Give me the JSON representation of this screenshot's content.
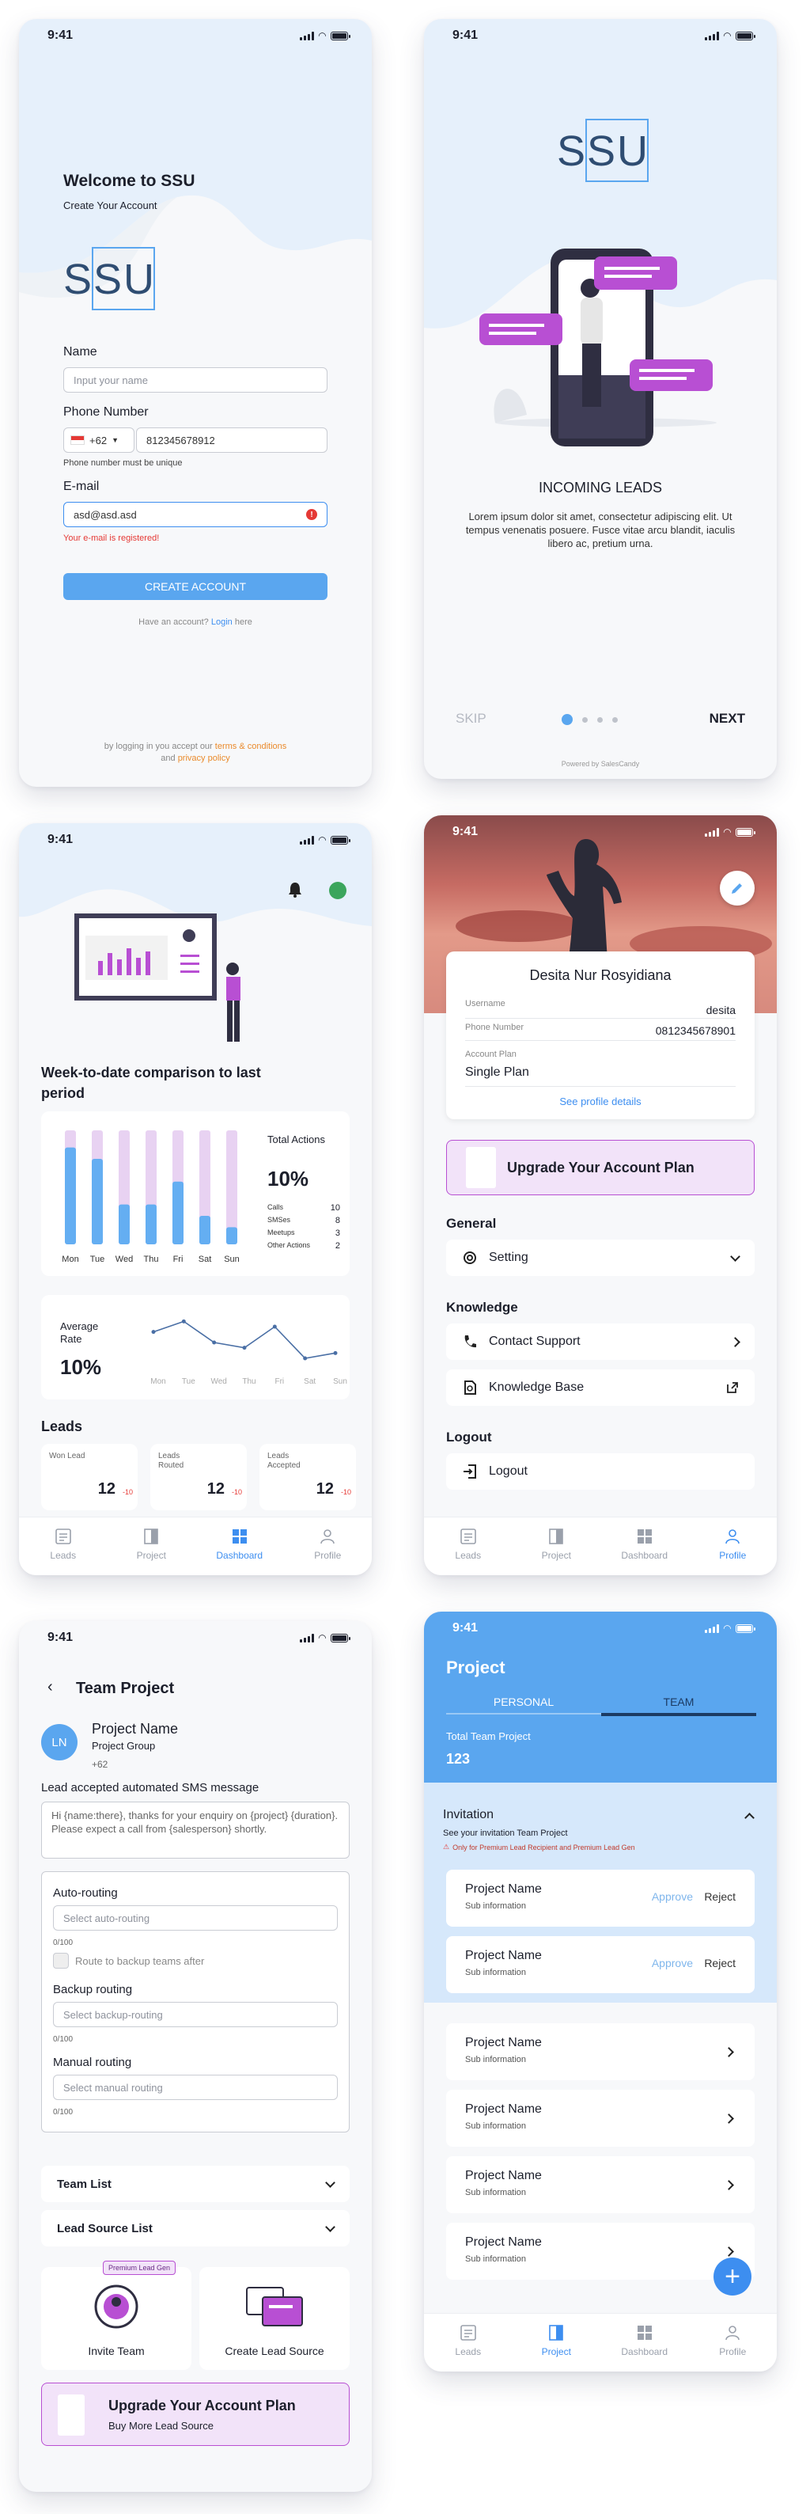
{
  "colors": {
    "primary": "#5aa6ef",
    "accent": "#3d8ef0",
    "purple": "#b84fd3",
    "error": "#e53935",
    "orange": "#ea8a2b",
    "light_blue": "#e6f0fb"
  },
  "status": {
    "time": "9:41"
  },
  "signup": {
    "welcome": "Welcome to SSU",
    "subtitle": "Create Your Account",
    "logo": "SSU",
    "name_label": "Name",
    "name_placeholder": "Input your name",
    "phone_label": "Phone Number",
    "country_code": "+62",
    "phone_value": "812345678912",
    "phone_hint": "Phone number must be unique",
    "email_label": "E-mail",
    "email_value": "asd@asd.asd",
    "email_error": "Your e-mail is registered!",
    "create_button": "CREATE ACCOUNT",
    "have_account": "Have an account?",
    "login_link": "Login",
    "here": "here",
    "terms_prefix": "by logging in you accept our",
    "terms_link": "terms & conditions",
    "and": "and",
    "privacy_link": "privacy policy"
  },
  "onboard": {
    "logo": "SSU",
    "title": "INCOMING LEADS",
    "body": "Lorem ipsum dolor sit amet, consectetur adipiscing elit. Ut tempus venenatis posuere. Fusce vitae arcu blandit, iaculis libero ac, pretium urna.",
    "skip": "SKIP",
    "next": "NEXT",
    "powered": "Powered by SalesCandy"
  },
  "dashboard": {
    "headline": "Week-to-date comparison to last period",
    "total_label": "Total Actions",
    "total_value": "10%",
    "stats": [
      {
        "label": "Calls",
        "value": "10"
      },
      {
        "label": "SMSes",
        "value": "8"
      },
      {
        "label": "Meetups",
        "value": "3"
      },
      {
        "label": "Other Actions",
        "value": "2"
      }
    ],
    "avg_label": "Average Rate",
    "avg_value": "10%",
    "leads_title": "Leads",
    "leads": [
      {
        "label": "Won Lead",
        "value": "12",
        "delta": "-10"
      },
      {
        "label": "Leads Routed",
        "value": "12",
        "delta": "-10"
      },
      {
        "label": "Leads Accepted",
        "value": "12",
        "delta": "-10"
      }
    ]
  },
  "chart_data": [
    {
      "type": "bar",
      "categories": [
        "Mon",
        "Tue",
        "Wed",
        "Thu",
        "Fri",
        "Sat",
        "Sun"
      ],
      "series": [
        {
          "values": [
            85,
            75,
            35,
            35,
            55,
            25,
            15
          ]
        },
        {
          "values": [
            100,
            100,
            100,
            100,
            100,
            100,
            100
          ]
        }
      ],
      "ylim": [
        0,
        100
      ]
    },
    {
      "type": "line",
      "categories": [
        "Mon",
        "Tue",
        "Wed",
        "Thu",
        "Fri",
        "Sat",
        "Sun"
      ],
      "series": [
        {
          "values": [
            8,
            9,
            7,
            6.5,
            8.5,
            5.5,
            6
          ]
        }
      ],
      "ylim": [
        4,
        10
      ]
    }
  ],
  "profile": {
    "name": "Desita Nur Rosyidiana",
    "username_label": "Username",
    "username": "desita",
    "phone_label": "Phone Number",
    "phone": "0812345678901",
    "plan_label": "Account Plan",
    "plan": "Single Plan",
    "see_details": "See profile details",
    "upgrade": "Upgrade Your Account Plan",
    "general": "General",
    "setting": "Setting",
    "knowledge": "Knowledge",
    "contact": "Contact Support",
    "kb": "Knowledge Base",
    "logout_title": "Logout",
    "logout": "Logout"
  },
  "nav": {
    "leads": "Leads",
    "project": "Project",
    "dashboard": "Dashboard",
    "profile": "Profile"
  },
  "team": {
    "title": "Team Project",
    "avatar": "LN",
    "project_name": "Project Name",
    "project_group": "Project Group",
    "code": "+62",
    "sms_label": "Lead accepted automated SMS message",
    "sms_text": "Hi {name:there}, thanks for your enquiry on {project} {duration}. Please expect a call from {salesperson} shortly.",
    "auto_label": "Auto-routing",
    "auto_ph": "Select auto-routing",
    "count": "0/100",
    "backup_check": "Route to backup teams after",
    "backup_label": "Backup routing",
    "backup_ph": "Select backup-routing",
    "manual_label": "Manual routing",
    "manual_ph": "Select manual routing",
    "team_list": "Team List",
    "lead_source_list": "Lead Source List",
    "premium_badge": "Premium Lead Gen",
    "invite": "Invite Team",
    "create_source": "Create Lead Source",
    "upgrade": "Upgrade Your Account Plan",
    "buy_more": "Buy More Lead Source"
  },
  "project": {
    "title": "Project",
    "tab_personal": "PERSONAL",
    "tab_team": "TEAM",
    "total_label": "Total Team Project",
    "total": "123",
    "invitation": "Invitation",
    "invitation_sub": "See your invitation Team Project",
    "warn": "Only for Premium Lead Recipient and Premium Lead Gen",
    "approve": "Approve",
    "reject": "Reject",
    "items": [
      {
        "name": "Project Name",
        "sub": "Sub information"
      },
      {
        "name": "Project Name",
        "sub": "Sub information"
      },
      {
        "name": "Project Name",
        "sub": "Sub information"
      },
      {
        "name": "Project Name",
        "sub": "Sub information"
      },
      {
        "name": "Project Name",
        "sub": "Sub information"
      },
      {
        "name": "Project Name",
        "sub": "Sub information"
      }
    ]
  }
}
